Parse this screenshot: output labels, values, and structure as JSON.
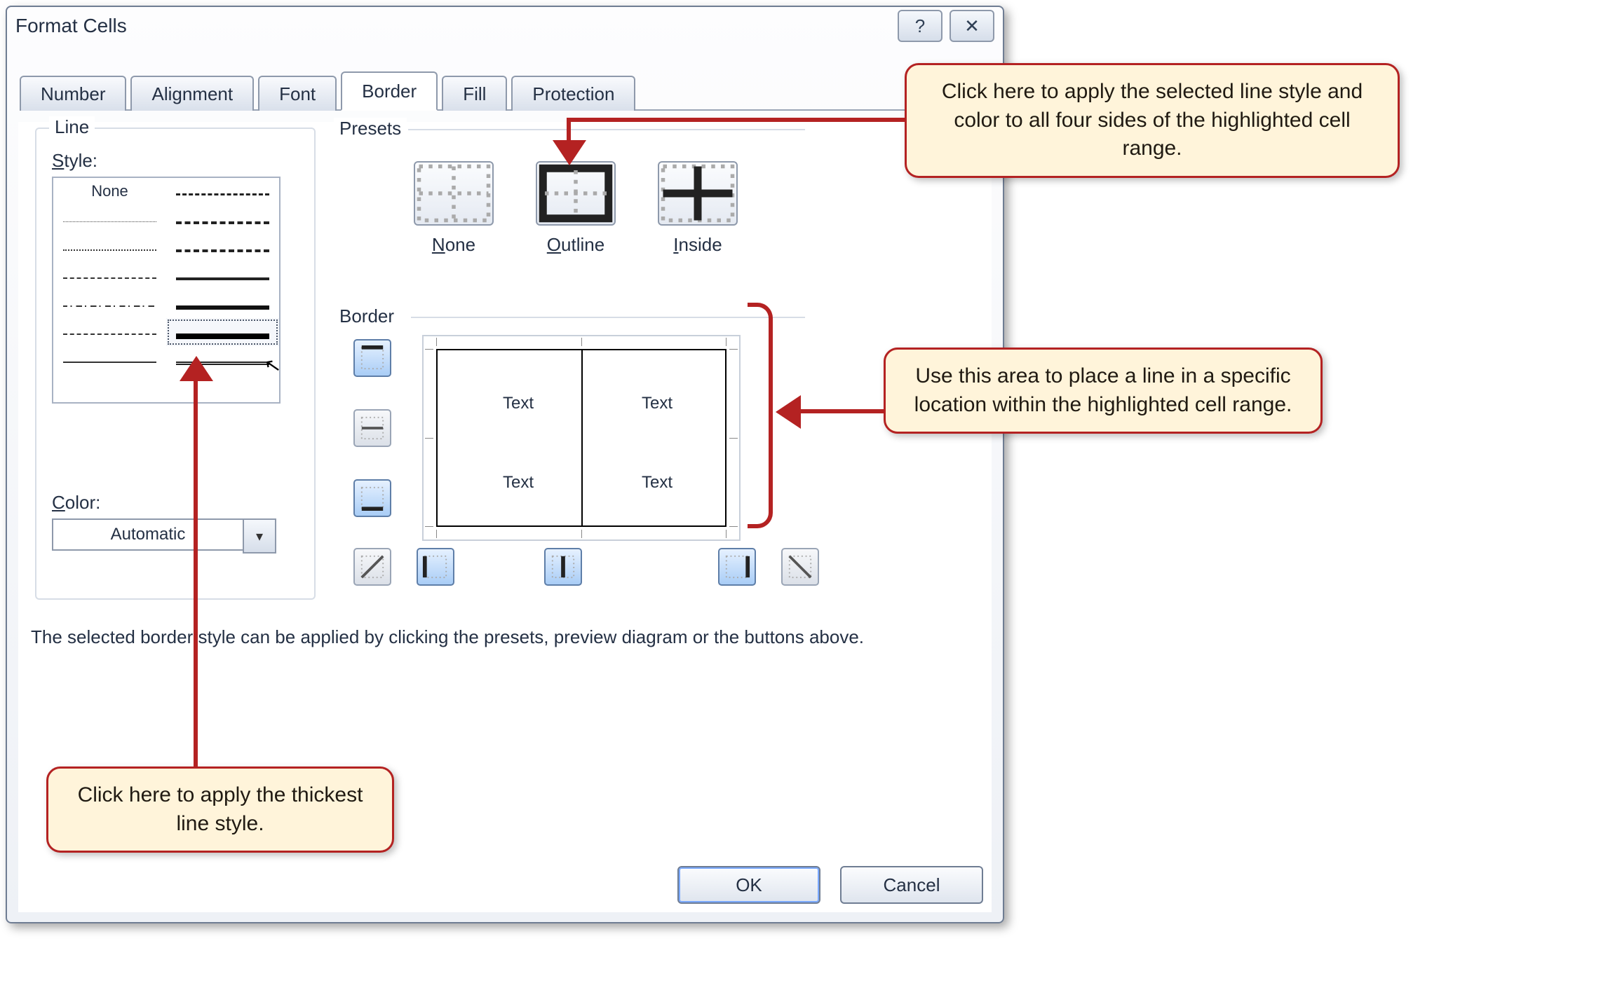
{
  "window": {
    "title": "Format Cells"
  },
  "tabs": [
    "Number",
    "Alignment",
    "Font",
    "Border",
    "Fill",
    "Protection"
  ],
  "active_tab": "Border",
  "line_group": {
    "legend": "Line",
    "style_label_pre": "S",
    "style_label_post": "tyle:",
    "none_label": "None",
    "color_label_pre": "C",
    "color_label_post": "olor:",
    "color_value": "Automatic"
  },
  "presets": {
    "label": "Presets",
    "none_pre": "N",
    "none_post": "one",
    "outline_pre": "O",
    "outline_post": "utline",
    "inside_pre": "I",
    "inside_post": "nside"
  },
  "border": {
    "label": "Border"
  },
  "preview_text": "Text",
  "explain": "The selected border style can be applied by clicking the presets, preview diagram or the buttons above.",
  "buttons": {
    "ok": "OK",
    "cancel": "Cancel"
  },
  "callouts": {
    "top_right": "Click here to apply the selected line style and color to all four sides of the highlighted cell range.",
    "mid_right": "Use this area to place a line in a specific location within the highlighted cell range.",
    "bottom_left": "Click here to apply the thickest line style."
  }
}
